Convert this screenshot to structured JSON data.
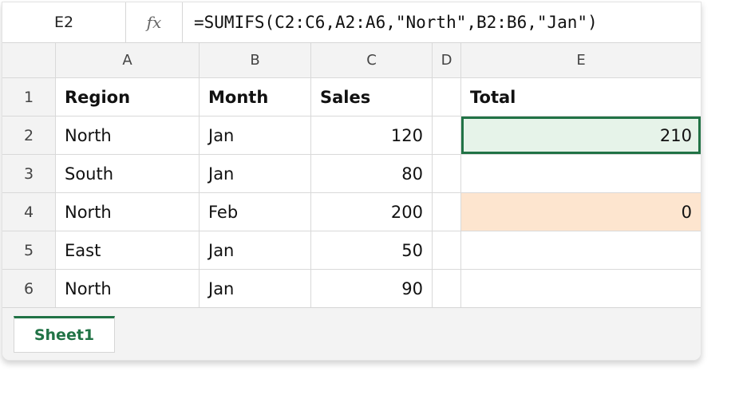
{
  "formula_bar": {
    "name_box": "E2",
    "fx_label": "fx",
    "formula": "=SUMIFS(C2:C6,A2:A6,\"North\",B2:B6,\"Jan\")"
  },
  "columns": [
    "A",
    "B",
    "C",
    "D",
    "E"
  ],
  "rows": [
    {
      "num": "1",
      "a": "Region",
      "b": "Month",
      "c": "Sales",
      "d": "",
      "e": "Total"
    },
    {
      "num": "2",
      "a": "North",
      "b": "Jan",
      "c": "120",
      "d": "",
      "e": "210"
    },
    {
      "num": "3",
      "a": "South",
      "b": "Jan",
      "c": "80",
      "d": "",
      "e": ""
    },
    {
      "num": "4",
      "a": "North",
      "b": "Feb",
      "c": "200",
      "d": "",
      "e": "0"
    },
    {
      "num": "5",
      "a": "East",
      "b": "Jan",
      "c": "50",
      "d": "",
      "e": ""
    },
    {
      "num": "6",
      "a": "North",
      "b": "Jan",
      "c": "90",
      "d": "",
      "e": ""
    }
  ],
  "sheet_tabs": [
    {
      "label": "Sheet1",
      "active": true
    }
  ],
  "colors": {
    "selection": "#217346",
    "selection_fill": "#e6f3e9",
    "highlight_orange": "#fde5cf"
  }
}
